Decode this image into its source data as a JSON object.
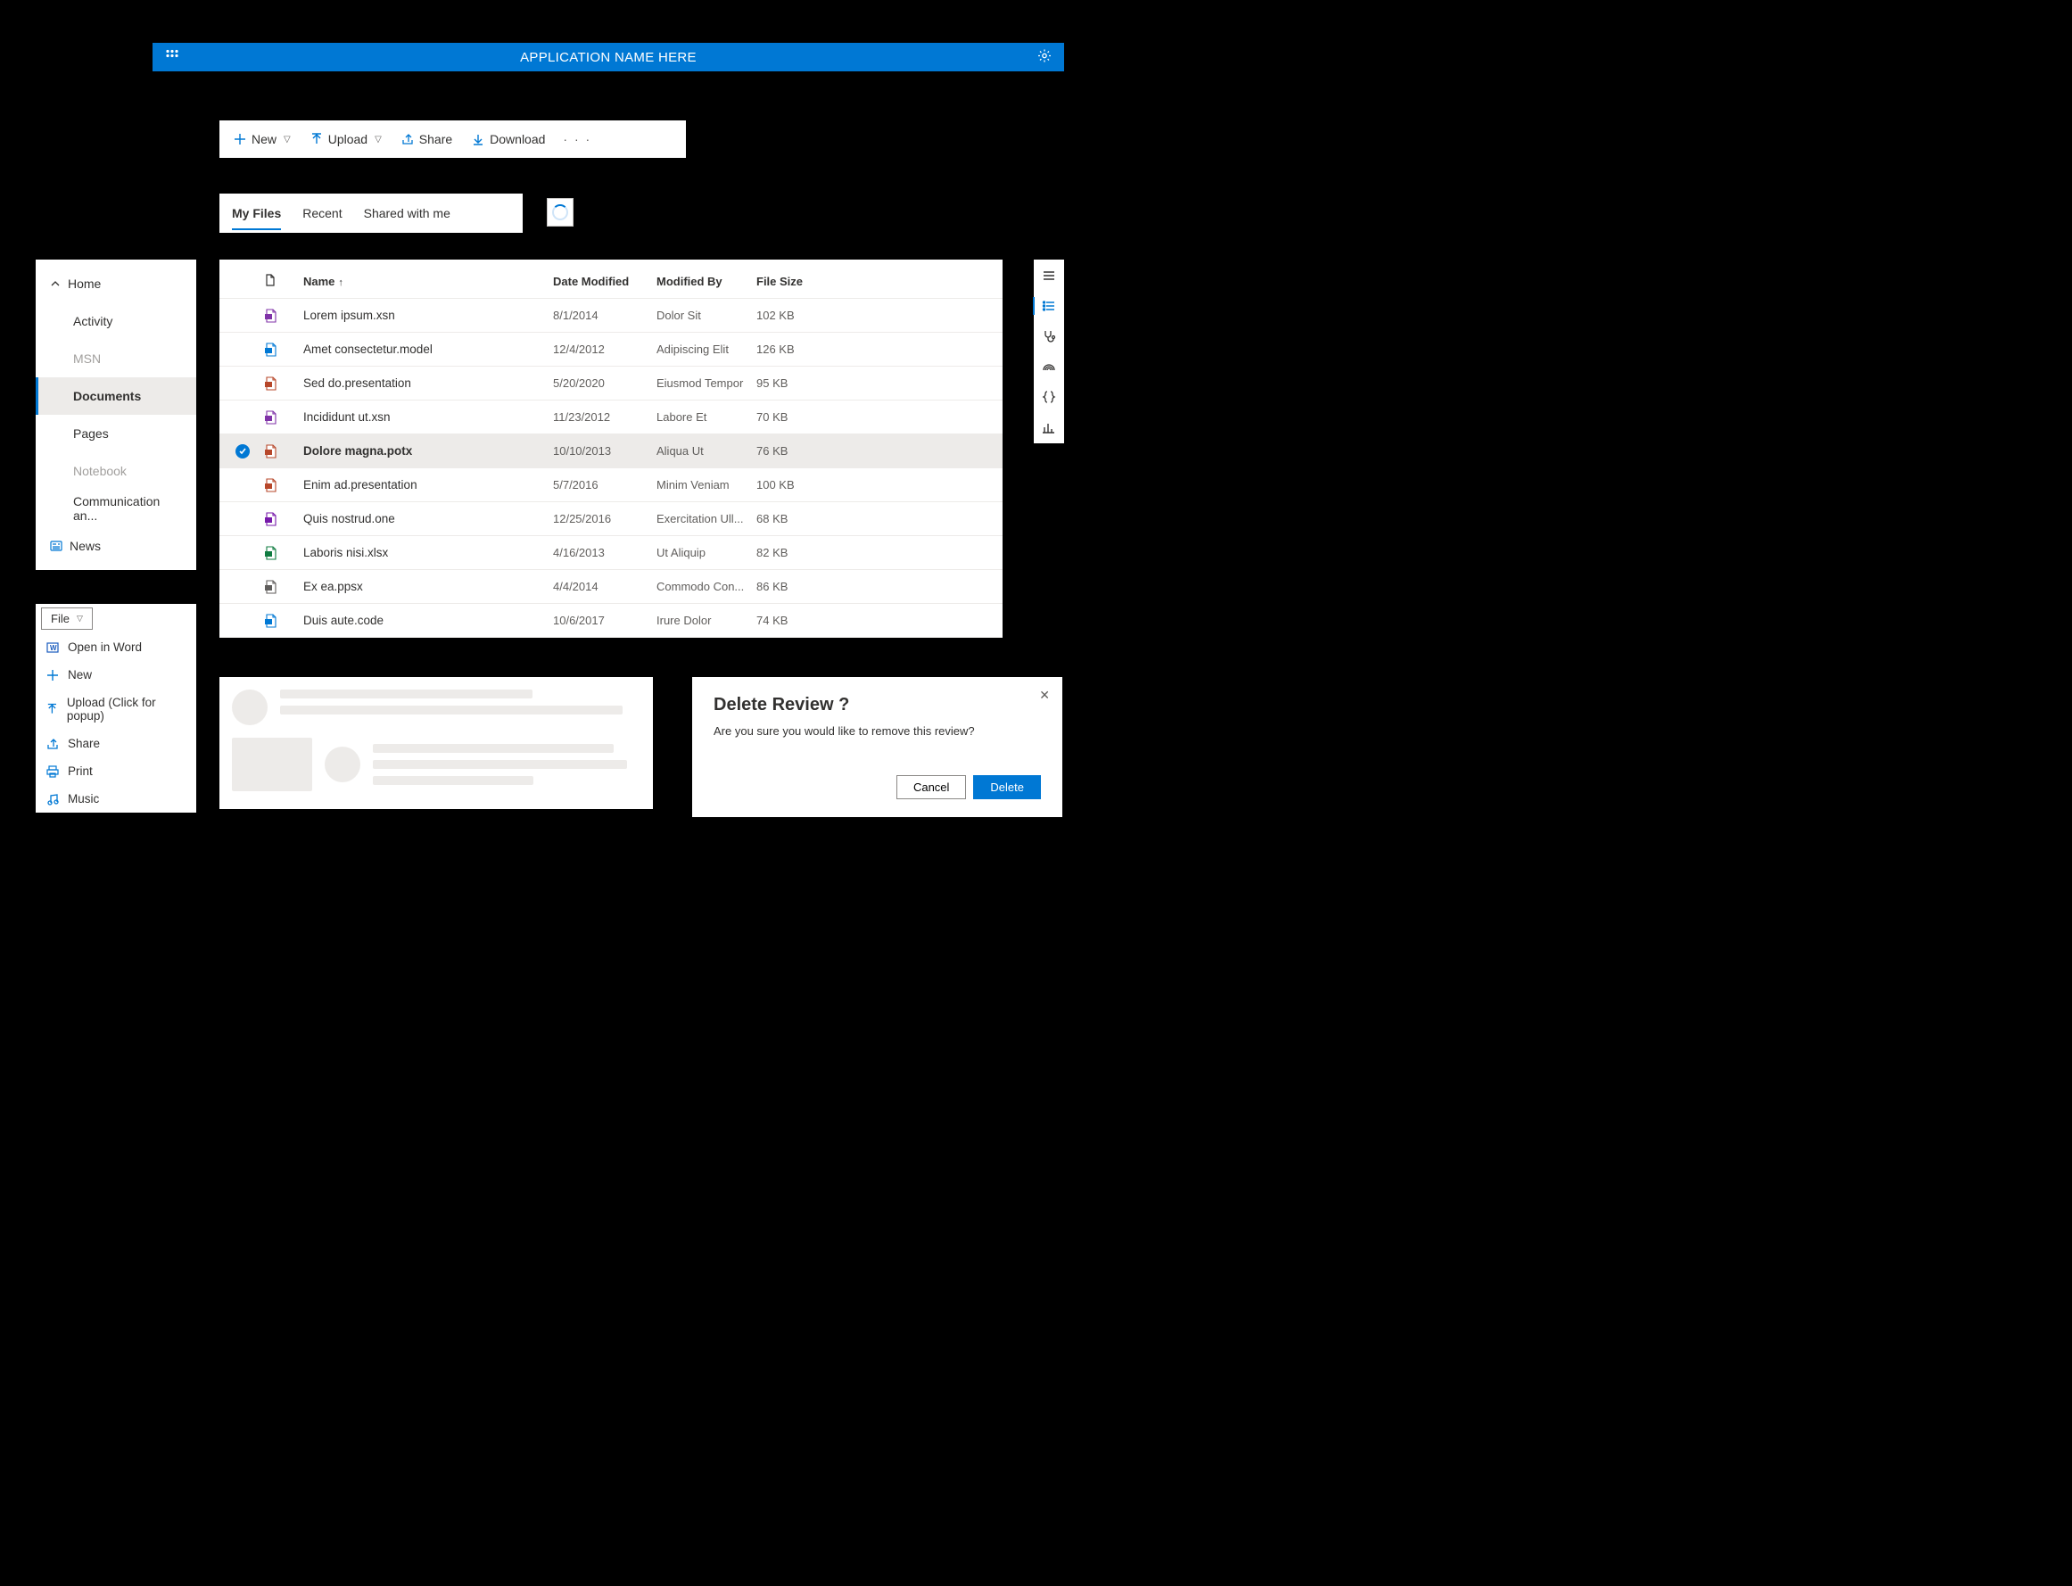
{
  "header": {
    "title": "APPLICATION NAME HERE"
  },
  "commandBar": {
    "new": "New",
    "upload": "Upload",
    "share": "Share",
    "download": "Download"
  },
  "tabs": {
    "items": [
      {
        "label": "My Files",
        "active": true
      },
      {
        "label": "Recent",
        "active": false
      },
      {
        "label": "Shared with me",
        "active": false
      }
    ]
  },
  "sidebar": {
    "home": "Home",
    "items": [
      {
        "label": "Activity",
        "disabled": false
      },
      {
        "label": "MSN",
        "disabled": true
      },
      {
        "label": "Documents",
        "disabled": false,
        "selected": true
      },
      {
        "label": "Pages",
        "disabled": false
      },
      {
        "label": "Notebook",
        "disabled": true
      },
      {
        "label": "Communication an...",
        "disabled": false
      }
    ],
    "news": "News"
  },
  "fileTable": {
    "columns": {
      "name": "Name",
      "dateModified": "Date Modified",
      "modifiedBy": "Modified By",
      "fileSize": "File Size"
    },
    "rows": [
      {
        "icon": "infopath",
        "name": "Lorem ipsum.xsn",
        "date": "8/1/2014",
        "by": "Dolor Sit",
        "size": "102 KB"
      },
      {
        "icon": "model",
        "name": "Amet consectetur.model",
        "date": "12/4/2012",
        "by": "Adipiscing Elit",
        "size": "126 KB"
      },
      {
        "icon": "presentation",
        "name": "Sed do.presentation",
        "date": "5/20/2020",
        "by": "Eiusmod Tempor",
        "size": "95 KB"
      },
      {
        "icon": "infopath",
        "name": "Incididunt ut.xsn",
        "date": "11/23/2012",
        "by": "Labore Et",
        "size": "70 KB"
      },
      {
        "icon": "powerpoint",
        "name": "Dolore magna.potx",
        "date": "10/10/2013",
        "by": "Aliqua Ut",
        "size": "76 KB",
        "selected": true
      },
      {
        "icon": "presentation",
        "name": "Enim ad.presentation",
        "date": "5/7/2016",
        "by": "Minim Veniam",
        "size": "100 KB"
      },
      {
        "icon": "onenote",
        "name": "Quis nostrud.one",
        "date": "12/25/2016",
        "by": "Exercitation Ull...",
        "size": "68 KB"
      },
      {
        "icon": "excel",
        "name": "Laboris nisi.xlsx",
        "date": "4/16/2013",
        "by": "Ut Aliquip",
        "size": "82 KB"
      },
      {
        "icon": "generic",
        "name": "Ex ea.ppsx",
        "date": "4/4/2014",
        "by": "Commodo Con...",
        "size": "86 KB"
      },
      {
        "icon": "code",
        "name": "Duis aute.code",
        "date": "10/6/2017",
        "by": "Irure Dolor",
        "size": "74 KB"
      }
    ]
  },
  "rail": {
    "icons": [
      "hamburger",
      "list",
      "stethoscope",
      "rainbow",
      "braces",
      "bar-chart"
    ],
    "active": "list"
  },
  "fileMenu": {
    "label": "File",
    "items": [
      {
        "icon": "word",
        "label": "Open in Word"
      },
      {
        "icon": "plus",
        "label": "New"
      },
      {
        "icon": "upload",
        "label": "Upload (Click for popup)"
      },
      {
        "icon": "share",
        "label": "Share"
      },
      {
        "icon": "print",
        "label": "Print"
      },
      {
        "icon": "music",
        "label": "Music"
      }
    ]
  },
  "dialog": {
    "title": "Delete Review ?",
    "body": "Are you sure you would like to remove this review?",
    "cancel": "Cancel",
    "confirm": "Delete"
  }
}
